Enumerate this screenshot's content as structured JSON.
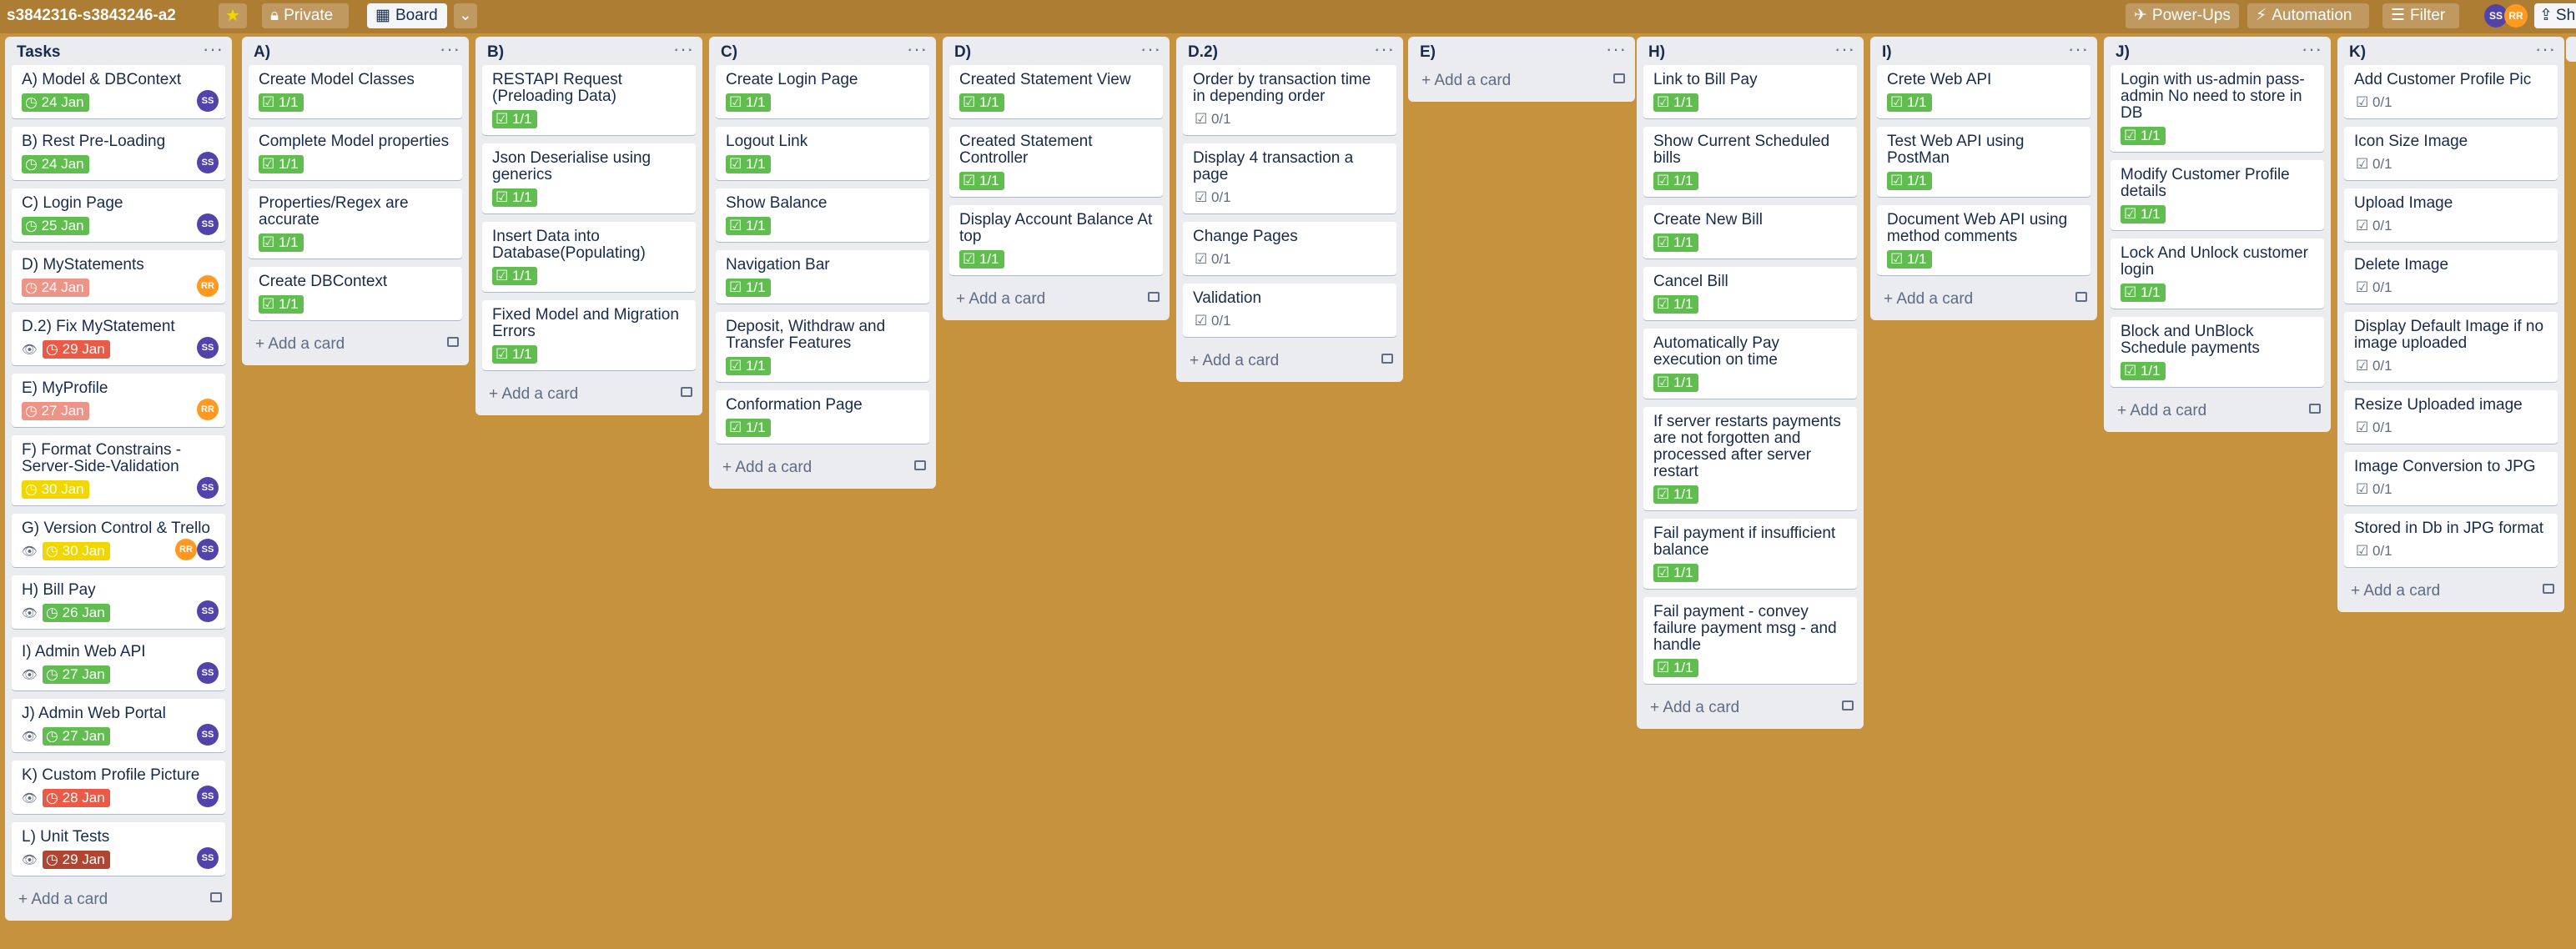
{
  "header": {
    "board_title": "s3842316-s3843246-a2",
    "star_icon": "star-icon",
    "visibility_label": "Private",
    "view_label": "Board",
    "powerups_label": "Power-Ups",
    "automation_label": "Automation",
    "filter_label": "Filter",
    "share_label": "Sh",
    "members": [
      "SS",
      "RR"
    ]
  },
  "colors": {
    "background": "#c6923e",
    "header": "#ad7d33",
    "list": "#ebecf0",
    "green_badge": "#61bd4f",
    "red_badge": "#eb5a46",
    "yellow_badge": "#f2d600",
    "member_ss": "#5243aa",
    "member_rr": "#ff991f"
  },
  "add_card_label": "Add a card",
  "lists": [
    {
      "title": "Tasks",
      "cards": [
        {
          "title": "A) Model & DBContext",
          "watch": false,
          "due": "24 Jan",
          "due_color": "green",
          "members": [
            "SS"
          ]
        },
        {
          "title": "B) Rest Pre-Loading",
          "watch": false,
          "due": "24 Jan",
          "due_color": "green",
          "members": [
            "SS"
          ]
        },
        {
          "title": "C) Login Page",
          "watch": false,
          "due": "25 Jan",
          "due_color": "green",
          "members": [
            "SS"
          ]
        },
        {
          "title": "D) MyStatements",
          "watch": false,
          "due": "24 Jan",
          "due_color": "salmon",
          "members": [
            "RR"
          ]
        },
        {
          "title": "D.2) Fix MyStatement",
          "watch": true,
          "due": "29 Jan",
          "due_color": "red",
          "members": [
            "SS"
          ]
        },
        {
          "title": "E) MyProfile",
          "watch": false,
          "due": "27 Jan",
          "due_color": "salmon",
          "members": [
            "RR"
          ]
        },
        {
          "title": "F) Format Constrains - Server-Side-Validation",
          "watch": false,
          "due": "30 Jan",
          "due_color": "yellow",
          "members": [
            "SS"
          ]
        },
        {
          "title": "G) Version Control & Trello",
          "watch": true,
          "due": "30 Jan",
          "due_color": "yellow",
          "members": [
            "RR",
            "SS"
          ]
        },
        {
          "title": "H) Bill Pay",
          "watch": true,
          "due": "26 Jan",
          "due_color": "green",
          "members": [
            "SS"
          ]
        },
        {
          "title": "I) Admin Web API",
          "watch": true,
          "due": "27 Jan",
          "due_color": "green",
          "members": [
            "SS"
          ]
        },
        {
          "title": "J) Admin Web Portal",
          "watch": true,
          "due": "27 Jan",
          "due_color": "green",
          "members": [
            "SS"
          ]
        },
        {
          "title": "K) Custom Profile Picture",
          "watch": true,
          "due": "28 Jan",
          "due_color": "red",
          "members": [
            "SS"
          ]
        },
        {
          "title": "L) Unit Tests",
          "watch": true,
          "due": "29 Jan",
          "due_color": "darkred",
          "members": [
            "SS"
          ]
        }
      ]
    },
    {
      "title": "A)",
      "cards": [
        {
          "title": "Create Model Classes",
          "check": "1/1",
          "done": true
        },
        {
          "title": "Complete Model properties",
          "check": "1/1",
          "done": true
        },
        {
          "title": "Properties/Regex are accurate",
          "check": "1/1",
          "done": true
        },
        {
          "title": "Create DBContext",
          "check": "1/1",
          "done": true
        }
      ]
    },
    {
      "title": "B)",
      "cards": [
        {
          "title": "RESTAPI Request (Preloading Data)",
          "check": "1/1",
          "done": true
        },
        {
          "title": "Json Deserialise using generics",
          "check": "1/1",
          "done": true
        },
        {
          "title": "Insert Data into Database(Populating)",
          "check": "1/1",
          "done": true
        },
        {
          "title": "Fixed Model and Migration Errors",
          "check": "1/1",
          "done": true
        }
      ]
    },
    {
      "title": "C)",
      "cards": [
        {
          "title": "Create Login Page",
          "check": "1/1",
          "done": true
        },
        {
          "title": "Logout Link",
          "check": "1/1",
          "done": true
        },
        {
          "title": "Show Balance",
          "check": "1/1",
          "done": true
        },
        {
          "title": "Navigation Bar",
          "check": "1/1",
          "done": true
        },
        {
          "title": "Deposit, Withdraw and Transfer Features",
          "check": "1/1",
          "done": true
        },
        {
          "title": "Conformation Page",
          "check": "1/1",
          "done": true
        }
      ]
    },
    {
      "title": "D)",
      "cards": [
        {
          "title": "Created Statement View",
          "check": "1/1",
          "done": true
        },
        {
          "title": "Created Statement Controller",
          "check": "1/1",
          "done": true
        },
        {
          "title": "Display Account Balance At top",
          "check": "1/1",
          "done": true
        }
      ]
    },
    {
      "title": "D.2)",
      "cards": [
        {
          "title": "Order by transaction time in depending order",
          "check": "0/1",
          "done": false
        },
        {
          "title": "Display 4 transaction a page",
          "check": "0/1",
          "done": false
        },
        {
          "title": "Change Pages",
          "check": "0/1",
          "done": false
        },
        {
          "title": "Validation",
          "check": "0/1",
          "done": false
        }
      ]
    },
    {
      "title": "E)",
      "cards": []
    },
    {
      "title": "H)",
      "cards": [
        {
          "title": "Link to Bill Pay",
          "check": "1/1",
          "done": true
        },
        {
          "title": "Show Current Scheduled bills",
          "check": "1/1",
          "done": true
        },
        {
          "title": "Create New Bill",
          "check": "1/1",
          "done": true
        },
        {
          "title": "Cancel Bill",
          "check": "1/1",
          "done": true
        },
        {
          "title": "Automatically Pay execution on time",
          "check": "1/1",
          "done": true
        },
        {
          "title": "If server restarts payments are not forgotten and processed after server restart",
          "check": "1/1",
          "done": true
        },
        {
          "title": "Fail payment if insufficient balance",
          "check": "1/1",
          "done": true
        },
        {
          "title": "Fail payment - convey failure payment msg - and handle",
          "check": "1/1",
          "done": true
        }
      ]
    },
    {
      "title": "I)",
      "cards": [
        {
          "title": "Crete Web API",
          "check": "1/1",
          "done": true
        },
        {
          "title": "Test Web API using PostMan",
          "check": "1/1",
          "done": true
        },
        {
          "title": "Document Web API using method comments",
          "check": "1/1",
          "done": true
        }
      ]
    },
    {
      "title": "J)",
      "cards": [
        {
          "title": "Login with us-admin pass-admin No need to store in DB",
          "check": "1/1",
          "done": true
        },
        {
          "title": "Modify Customer Profile details",
          "check": "1/1",
          "done": true
        },
        {
          "title": "Lock And Unlock customer login",
          "check": "1/1",
          "done": true
        },
        {
          "title": "Block and UnBlock Schedule payments",
          "check": "1/1",
          "done": true
        }
      ]
    },
    {
      "title": "K)",
      "cards": [
        {
          "title": "Add Customer Profile Pic",
          "check": "0/1",
          "done": false
        },
        {
          "title": "Icon Size Image",
          "check": "0/1",
          "done": false
        },
        {
          "title": "Upload Image",
          "check": "0/1",
          "done": false
        },
        {
          "title": "Delete Image",
          "check": "0/1",
          "done": false
        },
        {
          "title": "Display Default Image if no image uploaded",
          "check": "0/1",
          "done": false
        },
        {
          "title": "Resize Uploaded image",
          "check": "0/1",
          "done": false
        },
        {
          "title": "Image Conversion to JPG",
          "check": "0/1",
          "done": false
        },
        {
          "title": "Stored in Db in JPG format",
          "check": "0/1",
          "done": false
        }
      ]
    }
  ]
}
